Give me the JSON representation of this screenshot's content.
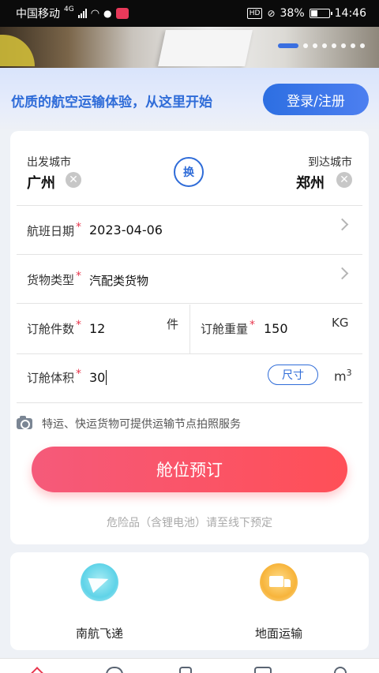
{
  "status_bar": {
    "carrier": "中国移动",
    "network": "4G",
    "battery": "38%",
    "battery_level": 0.38,
    "time": "14:46"
  },
  "banner": {
    "slide_count": 8,
    "active_slide": 1
  },
  "header": {
    "slogan": "优质的航空运输体验，从这里开始",
    "login_label": "登录/注册"
  },
  "form": {
    "origin_label": "出发城市",
    "origin_value": "广州",
    "destination_label": "到达城市",
    "destination_value": "郑州",
    "swap_label": "换",
    "date_label": "航班日期",
    "date_value": "2023-04-06",
    "cargo_type_label": "货物类型",
    "cargo_type_value": "汽配类货物",
    "pieces_label": "订舱件数",
    "pieces_value": "12",
    "pieces_unit": "件",
    "weight_label": "订舱重量",
    "weight_value": "150",
    "weight_unit": "KG",
    "volume_label": "订舱体积",
    "volume_value": "30",
    "size_button": "尺寸",
    "volume_unit": "m",
    "volume_unit_sup": "3",
    "required_mark": "*",
    "clear_glyph": "✕"
  },
  "photo_note": "特运、快运货物可提供运输节点拍照服务",
  "book_button": "舱位预订",
  "danger_note": "危险品（含锂电池）请至线下预定",
  "services": [
    {
      "label": "南航飞递",
      "icon": "plane-icon",
      "color": "#5fd3e8"
    },
    {
      "label": "地面运输",
      "icon": "truck-icon",
      "color": "#f7b43b"
    }
  ],
  "colors": {
    "accent_blue": "#2f6cd8",
    "accent_red": "#ff4f57"
  }
}
